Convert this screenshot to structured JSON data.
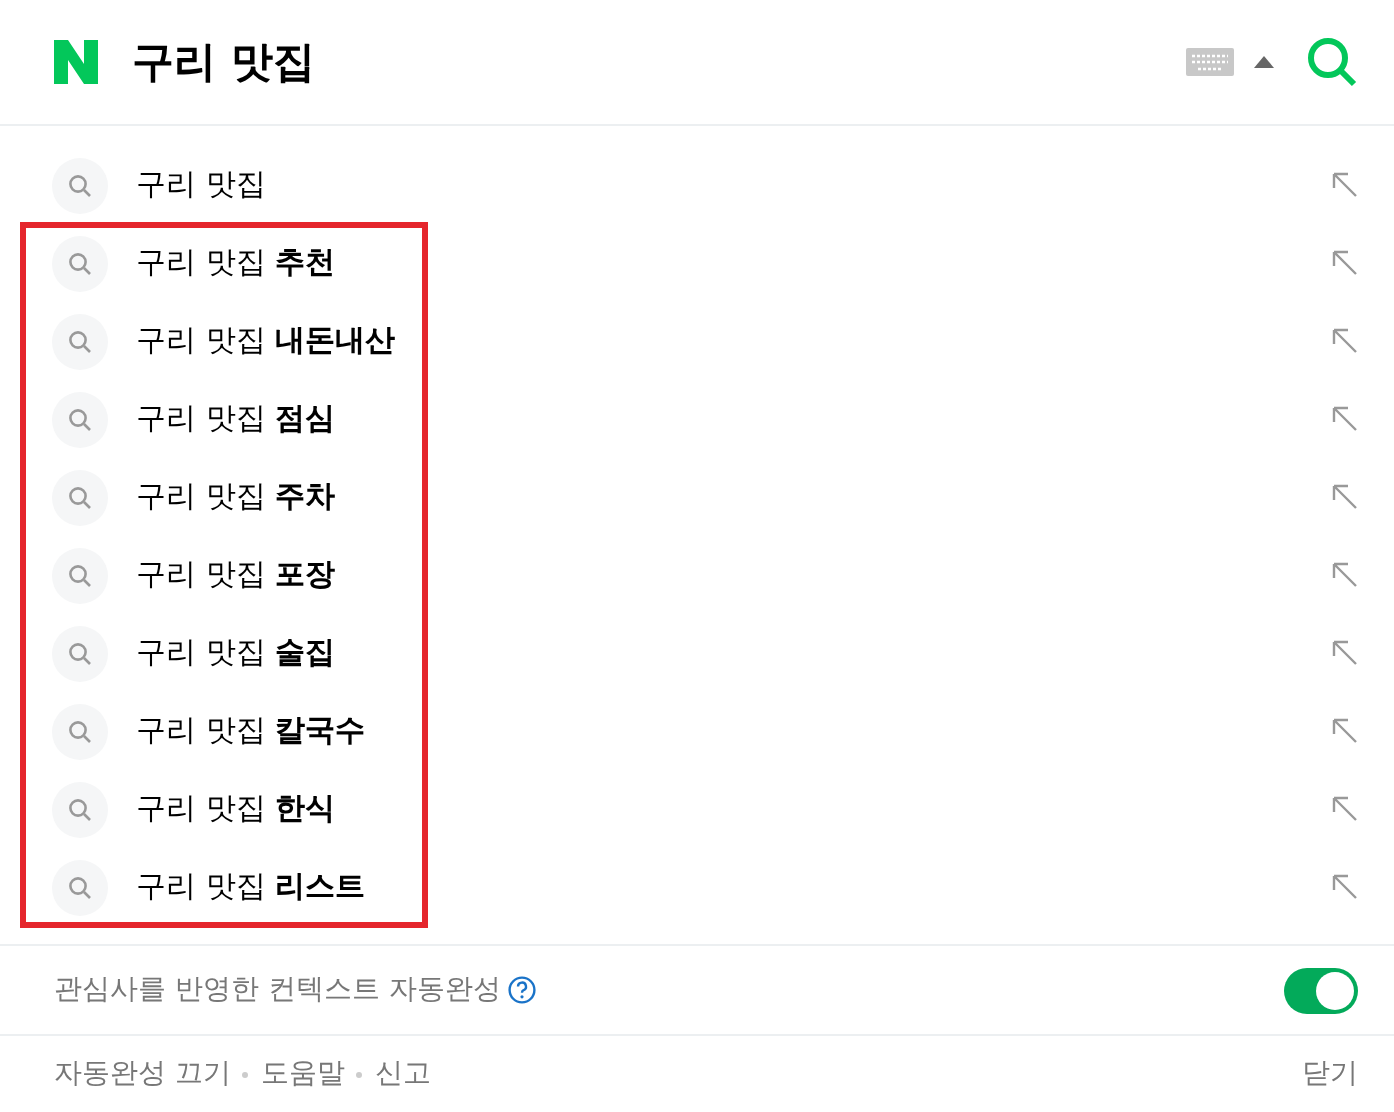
{
  "search": {
    "value": "구리 맛집"
  },
  "suggestions": [
    {
      "text": "구리 맛집",
      "highlighted": false
    },
    {
      "text": "구리 맛집 **추천**",
      "highlighted": true
    },
    {
      "text": "구리 맛집 **내돈내산**",
      "highlighted": true
    },
    {
      "text": "구리 맛집 **점심**",
      "highlighted": true
    },
    {
      "text": "구리 맛집 **주차**",
      "highlighted": true
    },
    {
      "text": "구리 맛집 **포장**",
      "highlighted": true
    },
    {
      "text": "구리 맛집 **술집**",
      "highlighted": true
    },
    {
      "text": "구리 맛집 **칼국수**",
      "highlighted": true
    },
    {
      "text": "구리 맛집 **한식**",
      "highlighted": true
    },
    {
      "text": "구리 맛집 **리스트**",
      "highlighted": true
    }
  ],
  "context_setting": {
    "label": "관심사를 반영한 컨텍스트 자동완성",
    "on": true
  },
  "footer": {
    "links": [
      "자동완성 끄기",
      "도움말",
      "신고"
    ],
    "close": "닫기"
  }
}
